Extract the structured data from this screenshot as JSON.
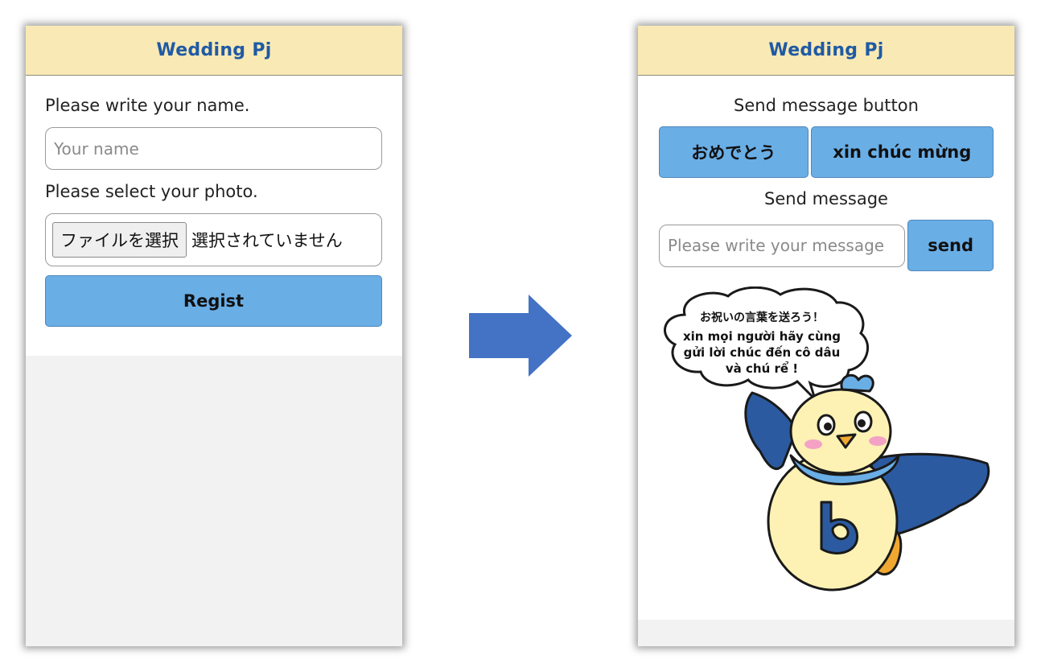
{
  "left_screen": {
    "header": {
      "title": "Wedding Pj"
    },
    "name_label": "Please write your name.",
    "name_input": {
      "placeholder": "Your name",
      "value": ""
    },
    "photo_label": "Please select your photo.",
    "file_picker": {
      "button_label": "ファイルを選択",
      "status": "選択されていません"
    },
    "regist_label": "Regist"
  },
  "arrow": {
    "icon": "arrow-right-icon",
    "color": "#4472c4"
  },
  "right_screen": {
    "header": {
      "title": "Wedding Pj"
    },
    "quick_section_label": "Send message button",
    "quick_buttons": [
      "おめでとう",
      "xin chúc mừng"
    ],
    "message_section_label": "Send message",
    "message_input": {
      "placeholder": "Please write your message",
      "value": ""
    },
    "send_label": "send",
    "mascot_bubble": {
      "line1": "お祝いの言葉を送ろう！",
      "line2": "xin mọi người hãy cùng",
      "line3": "gửi lời chúc đến cô dâu",
      "line4": "và chú rể !"
    }
  },
  "colors": {
    "header_bg": "#f9e9b4",
    "title": "#1f5aa5",
    "button": "#6aaee6",
    "arrow": "#4472c4"
  }
}
